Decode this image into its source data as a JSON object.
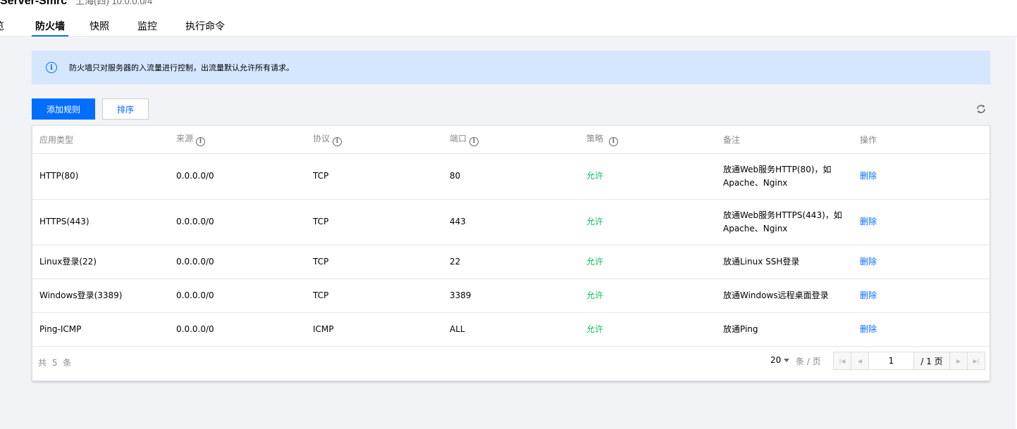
{
  "header": {
    "title": "Server-Smrc",
    "subtitle": "上海(四) 10.0.0.0/4"
  },
  "tabs": [
    {
      "label": "概览"
    },
    {
      "label": "防火墙"
    },
    {
      "label": "快照"
    },
    {
      "label": "监控"
    },
    {
      "label": "执行命令"
    }
  ],
  "notice": {
    "icon": "info-icon",
    "text": "防火墙只对服务器的入流量进行控制，出流量默认允许所有请求。"
  },
  "toolbar": {
    "add_label": "添加规则",
    "sort_label": "排序",
    "refresh_icon": "refresh-icon"
  },
  "table": {
    "columns": [
      "应用类型",
      "来源",
      "协议",
      "端口",
      "策略",
      "备注",
      "操作"
    ],
    "rows": [
      {
        "app": "HTTP(80)",
        "source": "0.0.0.0/0",
        "protocol": "TCP",
        "port": "80",
        "policy": "允许",
        "note": "放通Web服务HTTP(80)，如Apache、Nginx",
        "action": "删除"
      },
      {
        "app": "HTTPS(443)",
        "source": "0.0.0.0/0",
        "protocol": "TCP",
        "port": "443",
        "policy": "允许",
        "note": "放通Web服务HTTPS(443)，如Apache、Nginx",
        "action": "删除"
      },
      {
        "app": "Linux登录(22)",
        "source": "0.0.0.0/0",
        "protocol": "TCP",
        "port": "22",
        "policy": "允许",
        "note": "放通Linux SSH登录",
        "action": "删除"
      },
      {
        "app": "Windows登录(3389)",
        "source": "0.0.0.0/0",
        "protocol": "TCP",
        "port": "3389",
        "policy": "允许",
        "note": "放通Windows远程桌面登录",
        "action": "删除"
      },
      {
        "app": "Ping-ICMP",
        "source": "0.0.0.0/0",
        "protocol": "ICMP",
        "port": "ALL",
        "policy": "允许",
        "note": "放通Ping",
        "action": "删除"
      }
    ]
  },
  "pagination": {
    "total_text": "共 5 条",
    "page_size": "20",
    "per_page_label": "条 / 页",
    "current_page": "1",
    "total_pages": "/ 1 页"
  },
  "colors": {
    "primary": "#006eff",
    "allow": "#0abf5b",
    "notice_bg": "#d5e7ff"
  }
}
